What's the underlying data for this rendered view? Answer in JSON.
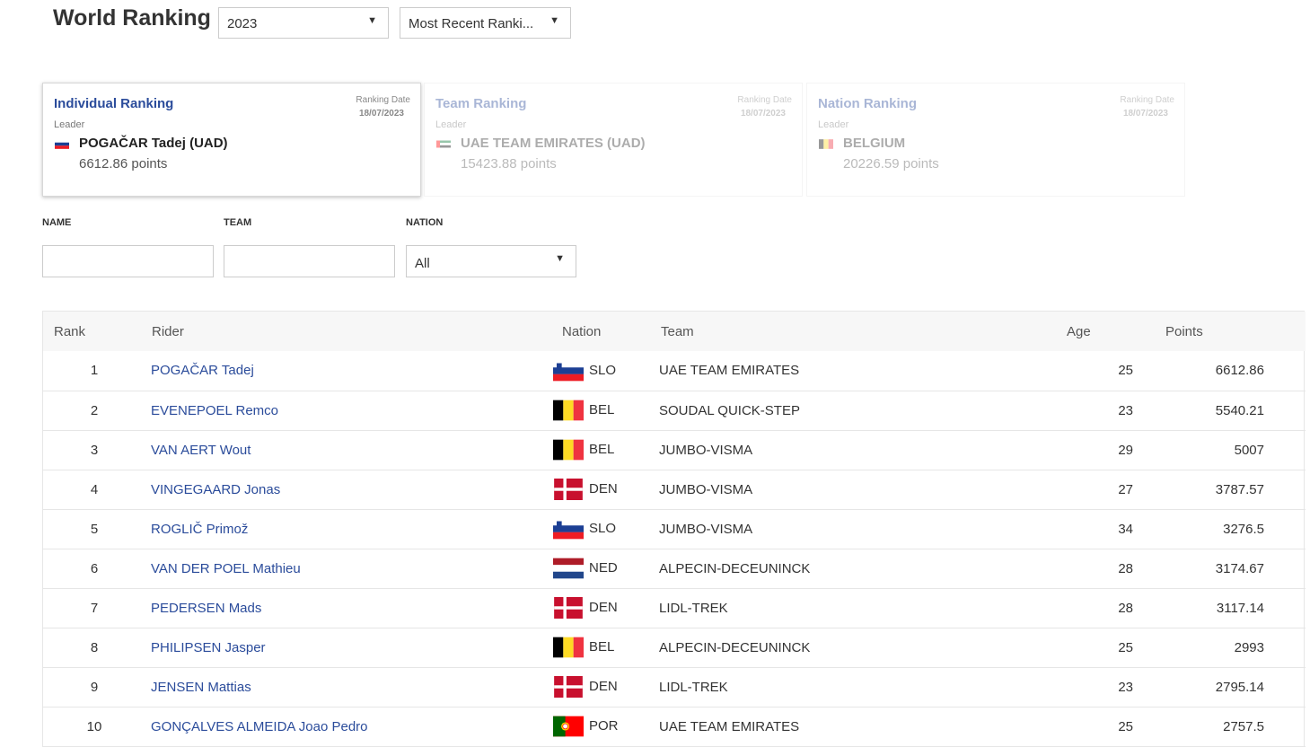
{
  "header": {
    "title": "World Ranking",
    "year_select": "2023",
    "period_select": "Most Recent Ranki..."
  },
  "cards": [
    {
      "title": "Individual Ranking",
      "date_label": "Ranking Date",
      "date": "18/07/2023",
      "leader_label": "Leader",
      "leader": "POGAČAR Tadej (UAD)",
      "points": "6612.86 points",
      "flag": "SLO"
    },
    {
      "title": "Team Ranking",
      "date_label": "Ranking Date",
      "date": "18/07/2023",
      "leader_label": "Leader",
      "leader": "UAE TEAM EMIRATES (UAD)",
      "points": "15423.88 points",
      "flag": "UAE"
    },
    {
      "title": "Nation Ranking",
      "date_label": "Ranking Date",
      "date": "18/07/2023",
      "leader_label": "Leader",
      "leader": "BELGIUM",
      "points": "20226.59 points",
      "flag": "BEL"
    }
  ],
  "filters": {
    "name_label": "NAME",
    "team_label": "TEAM",
    "nation_label": "NATION",
    "nation_value": "All"
  },
  "table": {
    "headers": {
      "rank": "Rank",
      "rider": "Rider",
      "nation": "Nation",
      "team": "Team",
      "age": "Age",
      "points": "Points"
    },
    "rows": [
      {
        "rank": "1",
        "rider": "POGAČAR Tadej",
        "nation": "SLO",
        "team": "UAE TEAM EMIRATES",
        "age": "25",
        "points": "6612.86"
      },
      {
        "rank": "2",
        "rider": "EVENEPOEL Remco",
        "nation": "BEL",
        "team": "SOUDAL QUICK-STEP",
        "age": "23",
        "points": "5540.21"
      },
      {
        "rank": "3",
        "rider": "VAN AERT Wout",
        "nation": "BEL",
        "team": "JUMBO-VISMA",
        "age": "29",
        "points": "5007"
      },
      {
        "rank": "4",
        "rider": "VINGEGAARD Jonas",
        "nation": "DEN",
        "team": "JUMBO-VISMA",
        "age": "27",
        "points": "3787.57"
      },
      {
        "rank": "5",
        "rider": "ROGLIČ Primož",
        "nation": "SLO",
        "team": "JUMBO-VISMA",
        "age": "34",
        "points": "3276.5"
      },
      {
        "rank": "6",
        "rider": "VAN DER POEL Mathieu",
        "nation": "NED",
        "team": "ALPECIN-DECEUNINCK",
        "age": "28",
        "points": "3174.67"
      },
      {
        "rank": "7",
        "rider": "PEDERSEN Mads",
        "nation": "DEN",
        "team": "LIDL-TREK",
        "age": "28",
        "points": "3117.14"
      },
      {
        "rank": "8",
        "rider": "PHILIPSEN Jasper",
        "nation": "BEL",
        "team": "ALPECIN-DECEUNINCK",
        "age": "25",
        "points": "2993"
      },
      {
        "rank": "9",
        "rider": "JENSEN Mattias",
        "nation": "DEN",
        "team": "LIDL-TREK",
        "age": "23",
        "points": "2795.14"
      },
      {
        "rank": "10",
        "rider": "GONÇALVES ALMEIDA Joao Pedro",
        "nation": "POR",
        "team": "UAE TEAM EMIRATES",
        "age": "25",
        "points": "2757.5"
      }
    ]
  },
  "colors": {
    "link": "#2b4c9b",
    "border": "#e6e6e6",
    "header_bg": "#f7f7f7"
  }
}
